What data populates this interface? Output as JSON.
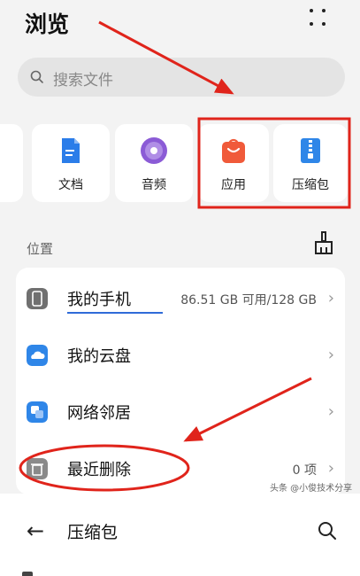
{
  "header": {
    "title": "浏览",
    "more_icon": "grid-dots-icon"
  },
  "search": {
    "placeholder": "搜索文件",
    "icon": "search-icon"
  },
  "categories": [
    {
      "label": "文档",
      "icon": "document-icon",
      "color": "#2b7de9"
    },
    {
      "label": "音频",
      "icon": "audio-icon",
      "color": "#8b5bd6"
    },
    {
      "label": "应用",
      "icon": "app-store-icon",
      "color": "#f05a3a"
    },
    {
      "label": "压缩包",
      "icon": "zip-icon",
      "color": "#2f86e8"
    }
  ],
  "locations": {
    "label": "位置",
    "clean_icon": "broom-icon",
    "items": [
      {
        "label": "我的手机",
        "value": "86.51 GB 可用/128 GB",
        "icon": "phone-icon"
      },
      {
        "label": "我的云盘",
        "value": "",
        "icon": "cloud-icon"
      },
      {
        "label": "网络邻居",
        "value": "",
        "icon": "network-icon"
      },
      {
        "label": "最近删除",
        "value": "0 项",
        "icon": "trash-icon"
      }
    ]
  },
  "watermark": "头条 @小俊技术分享",
  "bottom_bar": {
    "title": "压缩包",
    "back_icon": "back-arrow-icon",
    "search_icon": "search-icon"
  },
  "annotation_color": "#e0241b"
}
